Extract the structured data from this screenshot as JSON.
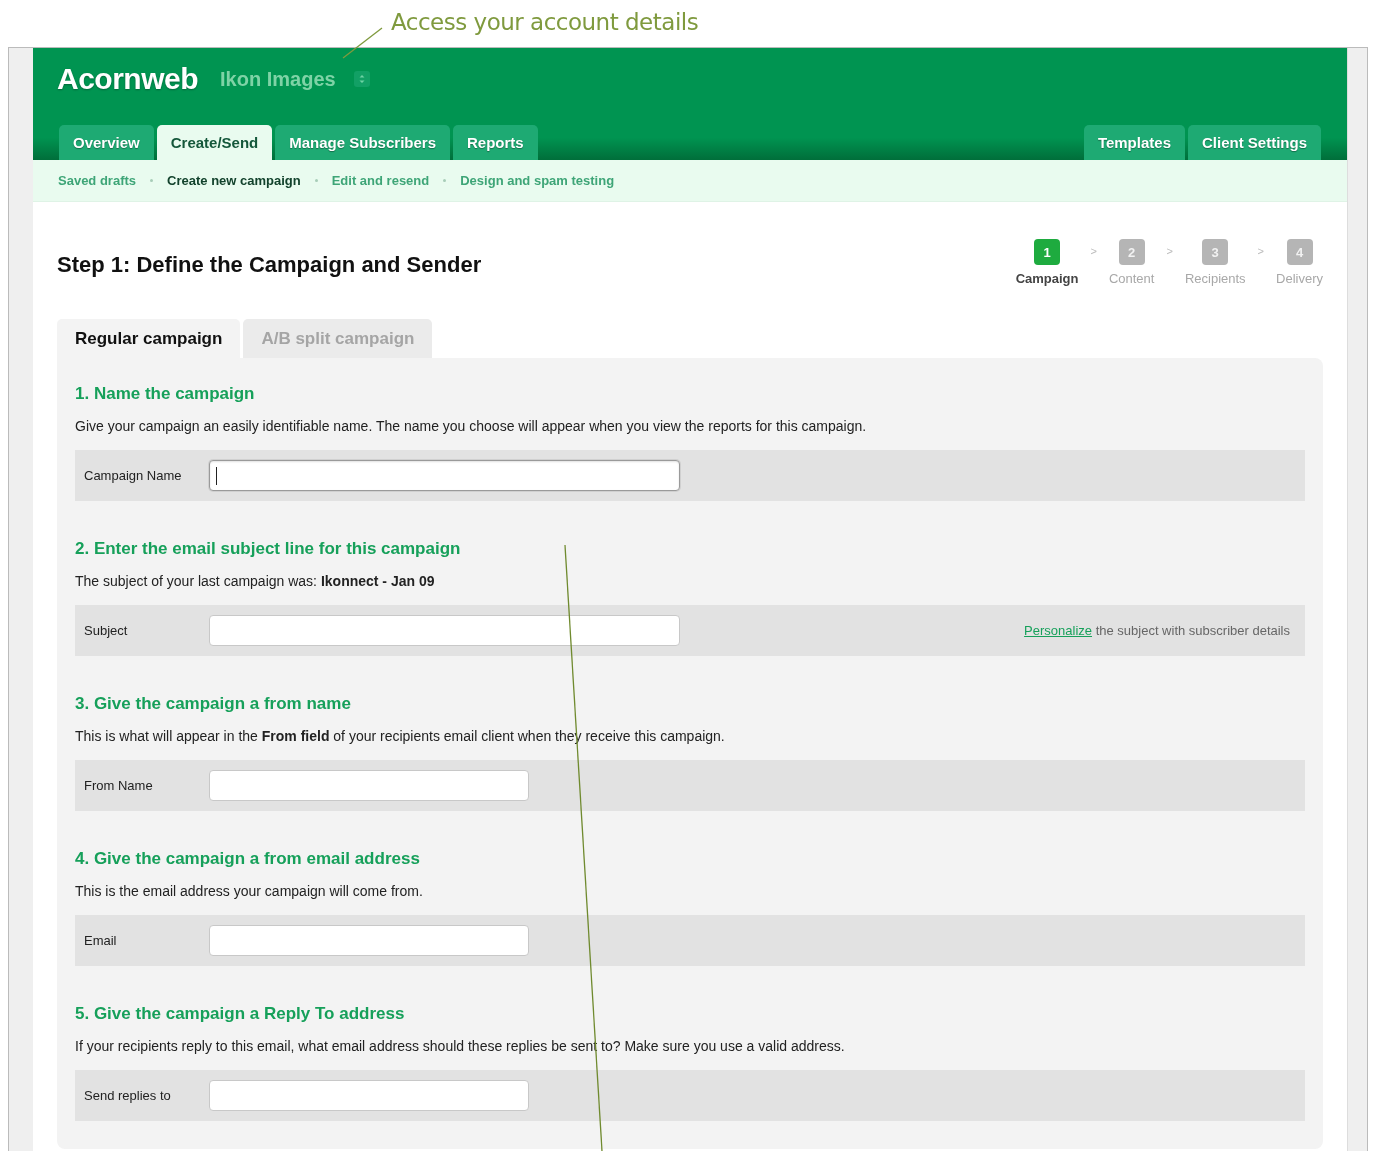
{
  "annotation": {
    "text": "Access your account details"
  },
  "header": {
    "logo": "Acornweb",
    "account": "Ikon Images"
  },
  "main_tabs": [
    {
      "label": "Overview",
      "selected": false
    },
    {
      "label": "Create/Send",
      "selected": true
    },
    {
      "label": "Manage Subscribers",
      "selected": false
    },
    {
      "label": "Reports",
      "selected": false
    }
  ],
  "right_tabs": [
    {
      "label": "Templates",
      "selected": false
    },
    {
      "label": "Client Settings",
      "selected": false
    }
  ],
  "subnav": [
    {
      "label": "Saved drafts",
      "selected": false
    },
    {
      "label": "Create new campaign",
      "selected": true
    },
    {
      "label": "Edit and resend",
      "selected": false
    },
    {
      "label": "Design and spam testing",
      "selected": false
    }
  ],
  "page_title": "Step 1: Define the Campaign and Sender",
  "steps": [
    {
      "number": "1",
      "label": "Campaign",
      "selected": true
    },
    {
      "number": "2",
      "label": "Content",
      "selected": false
    },
    {
      "number": "3",
      "label": "Recipients",
      "selected": false
    },
    {
      "number": "4",
      "label": "Delivery",
      "selected": false
    }
  ],
  "step_separator": ">",
  "campaign_tabs": [
    {
      "label": "Regular campaign",
      "selected": true
    },
    {
      "label": "A/B split campaign",
      "selected": false
    }
  ],
  "sections": [
    {
      "heading": "1. Name the campaign",
      "description": "Give your campaign an easily identifiable name. The name you choose will appear when you view the reports for this campaign.",
      "field_label": "Campaign Name",
      "focused": true
    },
    {
      "heading": "2. Enter the email subject line for this campaign",
      "description": "The subject of your last campaign was: **Ikonnect - Jan 09**",
      "field_label": "Subject",
      "focused": false,
      "link": "Personalize",
      "note": "the subject with subscriber details"
    },
    {
      "heading": "3. Give the campaign a from name",
      "description": "This is what will appear in the **From field** of your recipients email client when they receive this campaign.",
      "field_label": "From Name",
      "focused": false
    },
    {
      "heading": "4. Give the campaign a from email address",
      "description": "This is the email address your campaign will come from.",
      "field_label": "Email",
      "focused": false
    },
    {
      "heading": "5. Give the campaign a Reply To address",
      "description": "If your recipients reply to this email, what email address should these replies be sent to? Make sure you use a valid address.",
      "field_label": "Send replies to",
      "focused": false
    }
  ]
}
